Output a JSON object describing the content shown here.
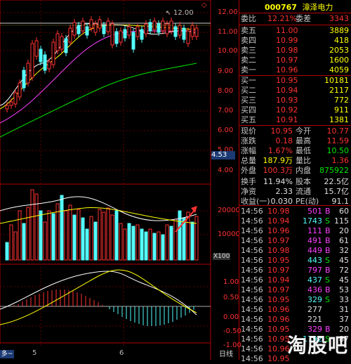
{
  "header": {
    "code": "000767",
    "name": "漳泽电力"
  },
  "chart": {
    "max_label": "12.00",
    "price_axis": [
      "12.00",
      "11.00",
      "10.00",
      "9.00",
      "8.00",
      "7.00",
      "6.00",
      "5.00",
      "4.00"
    ],
    "current_tag": "4.53",
    "volume_axis": [
      "20000",
      "10000"
    ],
    "volume_unit": "X100",
    "macd_axis": [
      "1.00",
      "0.50",
      "0.00",
      "-0.50",
      "-1.00"
    ],
    "x_labels": [
      "5",
      "6"
    ],
    "bottom_tab": "日线",
    "left_tab": "多~"
  },
  "quote": {
    "weibi": {
      "label": "委比",
      "value": "12.21%",
      "label2": "委差",
      "value2": "3343"
    },
    "asks": [
      {
        "label": "卖五",
        "price": "11.00",
        "vol": "3889"
      },
      {
        "label": "卖四",
        "price": "10.99",
        "vol": "418"
      },
      {
        "label": "卖三",
        "price": "10.98",
        "vol": "2053"
      },
      {
        "label": "卖二",
        "price": "10.97",
        "vol": "1600"
      },
      {
        "label": "卖一",
        "price": "10.96",
        "vol": "4059"
      }
    ],
    "bids": [
      {
        "label": "买一",
        "price": "10.95",
        "vol": "10181"
      },
      {
        "label": "买二",
        "price": "10.94",
        "vol": "2117"
      },
      {
        "label": "买三",
        "price": "10.93",
        "vol": "772"
      },
      {
        "label": "买四",
        "price": "10.92",
        "vol": "911"
      },
      {
        "label": "买五",
        "price": "10.91",
        "vol": "1381"
      }
    ],
    "stats": [
      {
        "l1": "现价",
        "v1": "10.95",
        "l2": "今开",
        "v2": "10.77"
      },
      {
        "l1": "涨跌",
        "v1": "0.18",
        "l2": "最高",
        "v2": "11.59"
      },
      {
        "l1": "涨幅",
        "v1": "1.67%",
        "l2": "最低",
        "v2": "10.50"
      },
      {
        "l1": "总量",
        "v1": "187.9万",
        "l2": "量比",
        "v2": "1.36"
      },
      {
        "l1": "外盘",
        "v1": "100.3万",
        "l2": "内盘",
        "v2": "875922"
      },
      {
        "l1": "换手",
        "v1": "11.94%",
        "l2": "股本",
        "v2": "22.5亿"
      },
      {
        "l1": "净资",
        "v1": "2.33",
        "l2": "流通",
        "v2": "15.7亿"
      },
      {
        "l1": "收益(一)",
        "v1": "0.030",
        "l2": "PE(动)",
        "v2": "91.1"
      }
    ],
    "trades": [
      {
        "t": "14:56",
        "p": "10.98",
        "v": "501",
        "d": "B",
        "n": "60"
      },
      {
        "t": "14:56",
        "p": "10.94",
        "v": "1743",
        "d": "S",
        "n": "115"
      },
      {
        "t": "14:56",
        "p": "10.96",
        "v": "111",
        "d": "B",
        "n": "20"
      },
      {
        "t": "14:56",
        "p": "10.97",
        "v": "491",
        "d": "B",
        "n": "61"
      },
      {
        "t": "14:56",
        "p": "10.98",
        "v": "449",
        "d": "B",
        "n": "32"
      },
      {
        "t": "14:56",
        "p": "10.95",
        "v": "443",
        "d": "S",
        "n": "45"
      },
      {
        "t": "14:56",
        "p": "10.97",
        "v": "797",
        "d": "B",
        "n": "72"
      },
      {
        "t": "14:56",
        "p": "10.94",
        "v": "437",
        "d": "S",
        "n": "45"
      },
      {
        "t": "14:56",
        "p": "10.97",
        "v": "436",
        "d": "B",
        "n": "53"
      },
      {
        "t": "14:56",
        "p": "10.95",
        "v": "329",
        "d": "S",
        "n": "33"
      },
      {
        "t": "14:56",
        "p": "10.96",
        "v": "277",
        "d": "",
        "n": "31"
      },
      {
        "t": "14:56",
        "p": "10.96",
        "v": "221",
        "d": "",
        "n": "37"
      },
      {
        "t": "14:56",
        "p": "10.95",
        "v": "329",
        "d": "B",
        "n": "20"
      },
      {
        "t": "14:56",
        "p": "10.95",
        "v": "1792",
        "d": "S",
        "n": "87"
      },
      {
        "t": "14:56",
        "p": "10.96",
        "v": "",
        "d": "",
        "n": ""
      },
      {
        "t": "14:56",
        "p": "10.95",
        "v": "",
        "d": "",
        "n": ""
      }
    ]
  },
  "watermark": "淘股吧",
  "colors": {
    "up": "#ff3232",
    "down": "#54fcfc",
    "grid": "#b00000",
    "ma5": "#ffffff",
    "ma10": "#ffff00",
    "ma20": "#ff40ff",
    "ma60": "#00e600"
  }
}
